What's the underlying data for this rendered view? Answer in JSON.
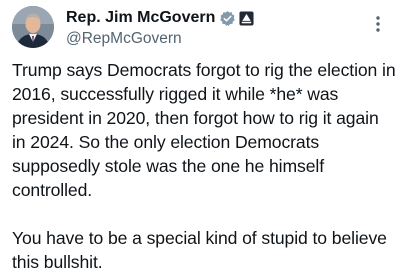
{
  "post": {
    "author": {
      "display_name": "Rep. Jim McGovern",
      "handle": "@RepMcGovern",
      "verified": true,
      "badge_color": "#829aab",
      "affiliation_icon": "government-building-icon"
    },
    "menu_icon": "more-vertical-icon",
    "text": {
      "paragraph_1": "Trump says Democrats forgot to rig the election in 2016, successfully rigged it while *he* was president in 2020, then forgot how to rig it again in 2024. So the only election Democrats supposedly stole was the one he himself controlled.",
      "paragraph_2": "You have to be a special kind of stupid to believe this bullshit."
    }
  },
  "colors": {
    "text_primary": "#0f1419",
    "text_secondary": "#536471"
  }
}
